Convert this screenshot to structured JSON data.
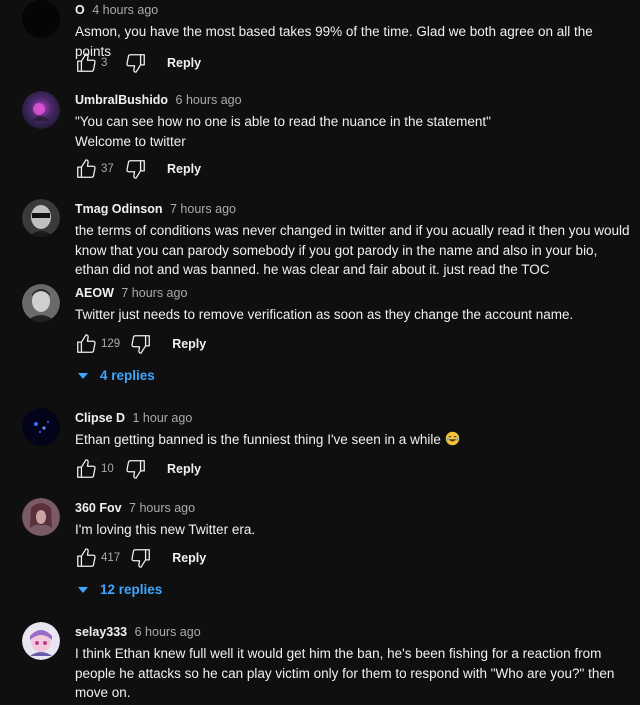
{
  "comments": [
    {
      "author": "O",
      "time": "4 hours ago",
      "text": "Asmon, you have the most based takes 99% of the time. Glad we both agree on all the points",
      "likes": "3",
      "reply_label": "Reply"
    },
    {
      "author": "UmbralBushido",
      "time": "6 hours ago",
      "text_lines": [
        "\"You can see how no one is able to read the nuance in the statement\"",
        "Welcome to twitter"
      ],
      "likes": "37",
      "reply_label": "Reply"
    },
    {
      "author": "Tmag Odinson",
      "time": "7 hours ago",
      "text": "the terms of conditions was never changed in twitter and if you acually read it then you would know that you can parody somebody if you got parody in the name and also in your bio, ethan did not and was banned. he was clear and fair about it. just read the TOC"
    },
    {
      "author": "AEOW",
      "time": "7 hours ago",
      "text": "Twitter just needs to remove verification as soon as they change the account name.",
      "likes": "129",
      "reply_label": "Reply",
      "replies_label": "4 replies"
    },
    {
      "author": "Clipse D",
      "time": "1 hour ago",
      "text": "Ethan getting banned is the funniest thing I've seen in a while",
      "likes": "10",
      "reply_label": "Reply"
    },
    {
      "author": "360 Fov",
      "time": "7 hours ago",
      "text": "I'm loving this new Twitter era.",
      "likes": "417",
      "reply_label": "Reply",
      "replies_label": "12 replies"
    },
    {
      "author": "selay333",
      "time": "6 hours ago",
      "text": "I think Ethan knew full well it would get him the ban, he's been fishing for a reaction from people he attacks so he can play victim only for them to respond with \"Who are you?\" then move on."
    }
  ],
  "colors": {
    "background": "#0f0f0f",
    "text": "#f1f1f1",
    "secondary_text": "#aaaaaa",
    "link_blue": "#3ea6ff"
  },
  "icons": {
    "like": "thumbs-up-outline-icon",
    "dislike": "thumbs-down-outline-icon",
    "replies": "caret-down-icon",
    "emoji": "laughing-tears-emoji"
  }
}
